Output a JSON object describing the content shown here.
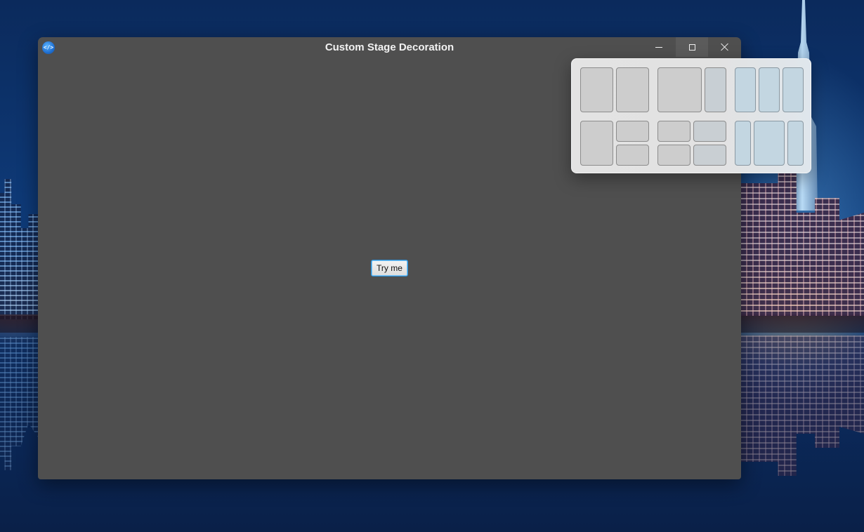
{
  "window": {
    "title": "Custom Stage Decoration",
    "app_icon": "code-brackets-icon",
    "app_icon_glyph": "</>",
    "controls": {
      "minimize_icon": "minimize-icon",
      "maximize_icon": "maximize-icon",
      "close_icon": "close-icon"
    }
  },
  "content": {
    "button_label": "Try me"
  },
  "snap_layouts": {
    "layouts": [
      {
        "name": "two-equal-columns",
        "zones": 2
      },
      {
        "name": "wide-left-narrow-right",
        "zones": 2
      },
      {
        "name": "three-equal-columns",
        "zones": 3
      },
      {
        "name": "left-column-right-stacked",
        "zones": 3
      },
      {
        "name": "four-quadrants",
        "zones": 4
      },
      {
        "name": "narrow-wide-narrow",
        "zones": 3
      }
    ]
  },
  "colors": {
    "window_background": "#4f4f4f",
    "title_text": "#f2f2f2",
    "button_focus_border": "#2b8fd6",
    "flyout_background": "#e3e3e3"
  }
}
